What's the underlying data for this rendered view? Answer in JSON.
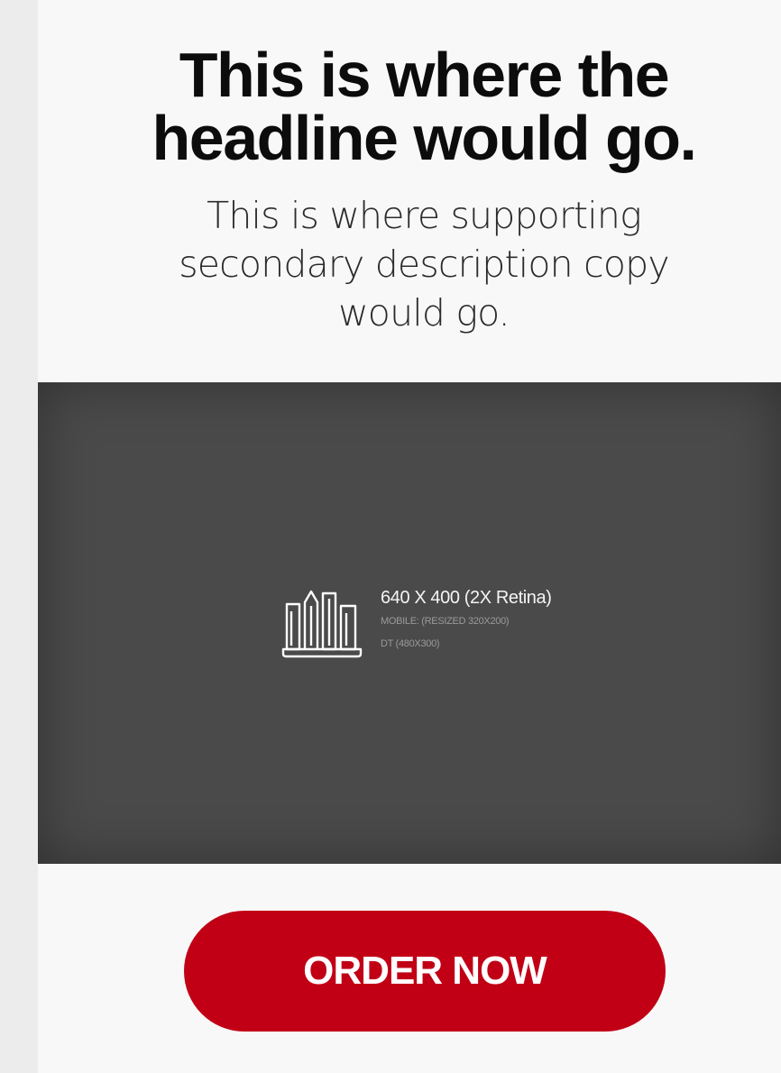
{
  "hero": {
    "headline_line1": "This is where the",
    "headline_line2": "headline would go.",
    "subcopy_line1": "This is where supporting",
    "subcopy_line2": "secondary description copy",
    "subcopy_line3": "would go."
  },
  "image_placeholder": {
    "icon": "city-buildings-icon",
    "title": "640 X 400 (2X Retina)",
    "line1": "MOBILE: (RESIZED 320X200)",
    "line2": "DT (480X300)"
  },
  "cta": {
    "label": "ORDER NOW"
  },
  "colors": {
    "page_background": "#f8f8f8",
    "gutter": "#ececec",
    "headline": "#0c0c0c",
    "placeholder_bg": "#4a4a4a",
    "cta": "#c10016",
    "cta_text": "#ffffff"
  }
}
